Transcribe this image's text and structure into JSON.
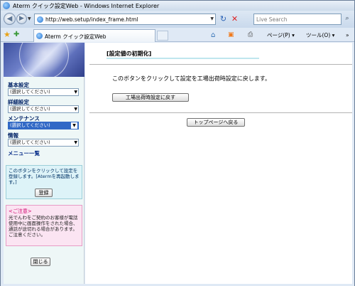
{
  "window": {
    "title": "Aterm クイック設定Web - Windows Internet Explorer"
  },
  "navigation": {
    "back_glyph": "◀",
    "forward_glyph": "▶",
    "address_url": "http://web.setup/index_frame.html",
    "refresh_glyph": "↻",
    "stop_glyph": "✕",
    "search_placeholder": "Live Search",
    "search_glyph": "⌕"
  },
  "tabbar": {
    "tab_label": "Aterm クイック設定Web",
    "commands": {
      "page": "ページ(P) ▾",
      "tools": "ツール(O) ▾",
      "more": "»"
    }
  },
  "sidebar": {
    "sections": [
      {
        "label": "基本設定",
        "select_value": "(選択してください)",
        "selected": false
      },
      {
        "label": "詳細設定",
        "select_value": "(選択してください)",
        "selected": false
      },
      {
        "label": "メンテナンス",
        "select_value": "(選択してください)",
        "selected": true
      },
      {
        "label": "情報",
        "select_value": "(選択してください)",
        "selected": false
      }
    ],
    "menu_list_link": "メニュー一覧",
    "login_box": {
      "message": "このボタンをクリックして設定を登録します。[Atermを再起動します。]",
      "button": "登録"
    },
    "notice_box": {
      "heading": "<ご注意>",
      "message": "光でんわをご契約のお客様が電話使用中に画面操作をされた場合、通話が途切れる場合があります。ご注意ください。"
    },
    "close_button": "閉じる"
  },
  "main": {
    "heading": "[設定値の初期化]",
    "description": "このボタンをクリックして設定を工場出荷時設定に戻します。",
    "reset_button": "工場出荷時設定に戻す",
    "top_page_button": "トップページへ戻る"
  },
  "colors": {
    "select_highlight": "#3169c6",
    "notice_heading": "#d0006b",
    "sidebar_background": "#eef7f7"
  }
}
